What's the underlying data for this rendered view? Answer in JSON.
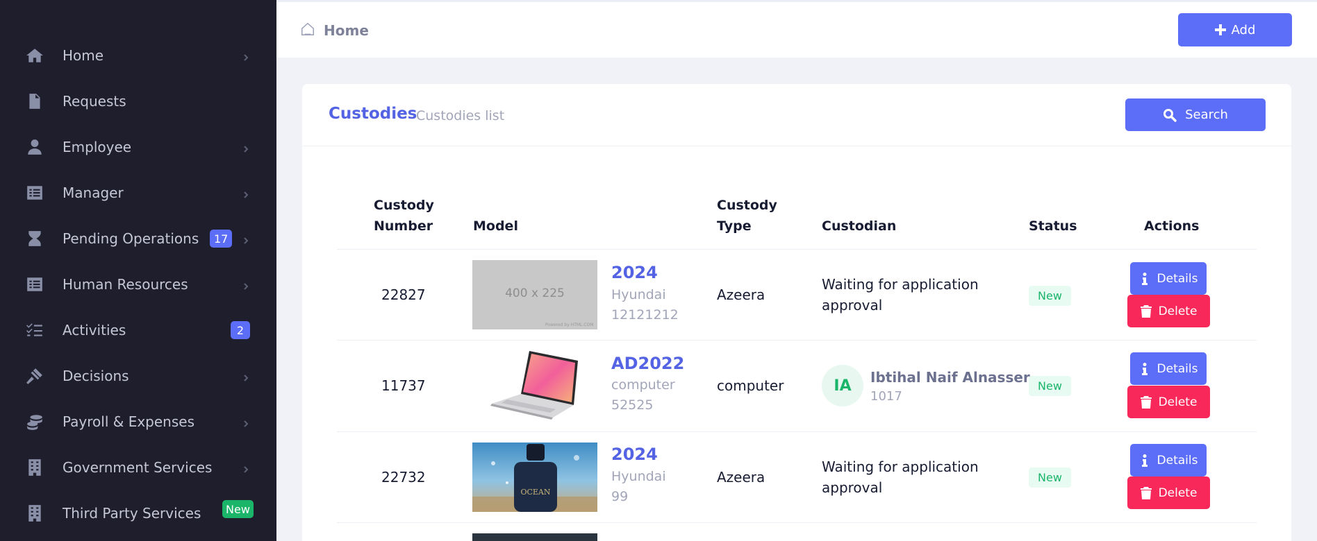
{
  "sidebar": {
    "items": [
      {
        "label": "Home",
        "icon": "home-icon"
      },
      {
        "label": "Requests",
        "icon": "document-icon"
      },
      {
        "label": "Employee",
        "icon": "user-icon"
      },
      {
        "label": "Manager",
        "icon": "list-icon"
      },
      {
        "label": "Pending Operations",
        "icon": "hourglass-icon",
        "badge": "17"
      },
      {
        "label": "Human Resources",
        "icon": "list-icon"
      },
      {
        "label": "Activities",
        "icon": "tasks-icon",
        "badge": "2"
      },
      {
        "label": "Decisions",
        "icon": "gavel-icon"
      },
      {
        "label": "Payroll & Expenses",
        "icon": "coins-icon"
      },
      {
        "label": "Government Services",
        "icon": "building-icon"
      },
      {
        "label": "Third Party Services",
        "icon": "building-icon",
        "badge": "New"
      }
    ]
  },
  "header": {
    "breadcrumb": "Home",
    "add_label": "Add"
  },
  "card": {
    "title": "Custodies",
    "subtitle": "Custodies list",
    "search_label": "Search"
  },
  "table": {
    "headers": {
      "number_line1": "Custody",
      "number_line2": "Number",
      "model": "Model",
      "type_line1": "Custody",
      "type_line2": "Type",
      "custodian": "Custodian",
      "status": "Status",
      "actions": "Actions"
    },
    "rows": [
      {
        "number": "22827",
        "image": "400 x 225",
        "image_credit": "Powered by HTML.COM",
        "model_title": "2024",
        "model_line1": "Hyundai",
        "model_line2": "12121212",
        "type": "Azeera",
        "custodian_line1": "Waiting for application",
        "custodian_line2": "approval",
        "status": "New",
        "details": "Details",
        "delete": "Delete"
      },
      {
        "number": "11737",
        "model_title": "AD2022",
        "model_line1": "computer",
        "model_line2": "52525",
        "type": "computer",
        "avatar": "IA",
        "custodian_name": "Ibtihal Naif Alnasser",
        "custodian_code": "1017",
        "status": "New",
        "details": "Details",
        "delete": "Delete"
      },
      {
        "number": "22732",
        "image_text": "OCEAN",
        "model_title": "2024",
        "model_line1": "Hyundai",
        "model_line2": "99",
        "type": "Azeera",
        "custodian_line1": "Waiting for application",
        "custodian_line2": "approval",
        "status": "New",
        "details": "Details",
        "delete": "Delete"
      }
    ]
  },
  "colors": {
    "primary": "#5c6ef8",
    "danger": "#f8285a",
    "success": "#1bb56a",
    "sidebar_bg": "#1e1e2d"
  }
}
